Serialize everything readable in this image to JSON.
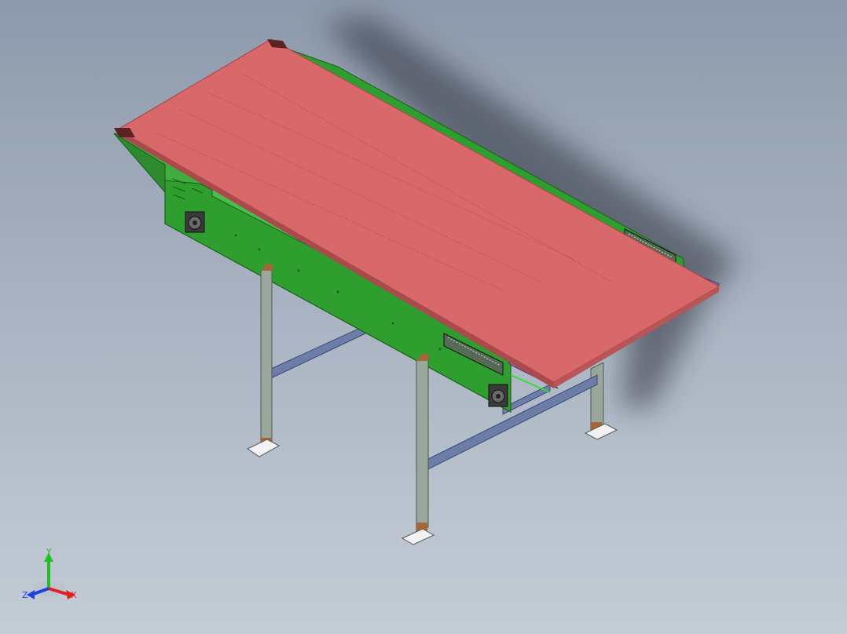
{
  "viewport": {
    "background_top": "#8e9aac",
    "background_bottom": "#c4ccd6",
    "model_name": "",
    "colors": {
      "belt": "#d9686a",
      "belt_edge": "#a94a4c",
      "frame": "#2e9e2e",
      "frame_dark": "#1f7a1f",
      "leg": "#9aa59b",
      "crossbar": "#6c7da8",
      "foot_pad": "#f2f2f2",
      "leg_foot": "#a5673a",
      "shadow": "#2a2f3a"
    },
    "icons": [
      "bearing-icon",
      "tensioner-icon",
      "coordinate-triad-icon"
    ]
  },
  "triad": {
    "x_label": "X",
    "y_label": "Y",
    "z_label": "Z",
    "x_color": "#e02020",
    "y_color": "#20c020",
    "z_color": "#2040e0"
  }
}
